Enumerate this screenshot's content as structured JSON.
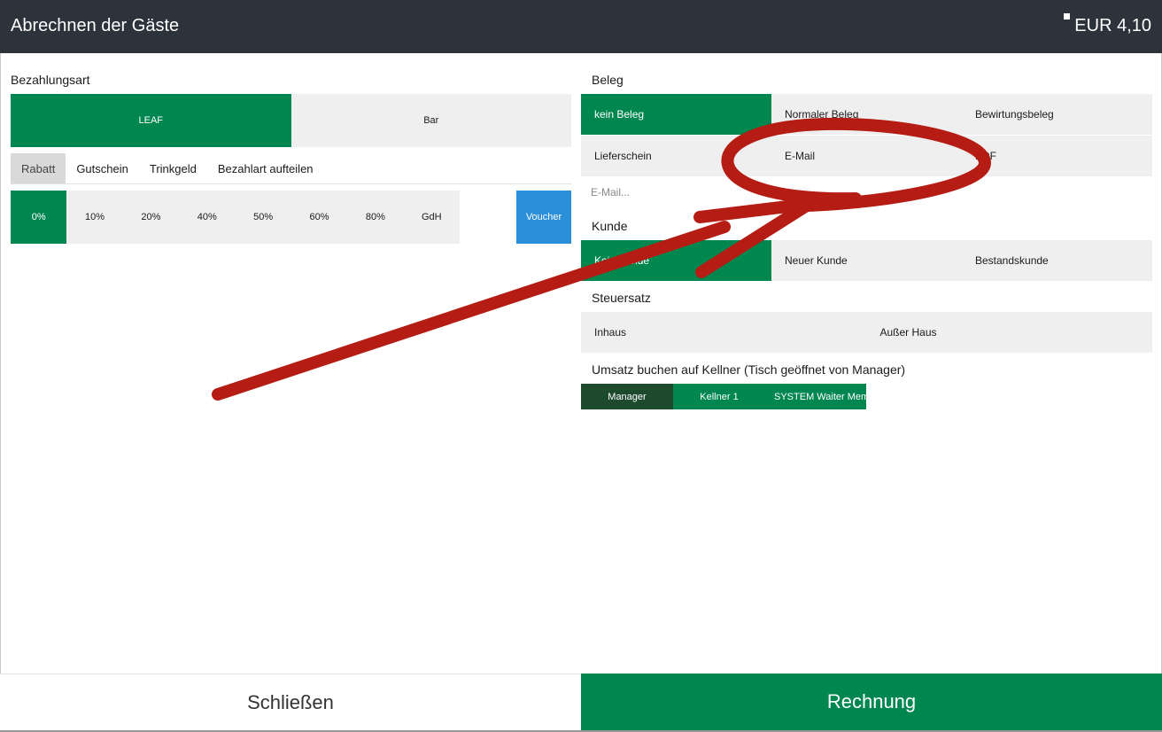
{
  "header": {
    "title": "Abrechnen der Gäste",
    "total": "EUR 4,10"
  },
  "payment": {
    "label": "Bezahlungsart",
    "methods": [
      {
        "label": "LEAF",
        "active": true
      },
      {
        "label": "Bar",
        "active": false
      }
    ]
  },
  "tabs": [
    {
      "label": "Rabatt",
      "active": true
    },
    {
      "label": "Gutschein",
      "active": false
    },
    {
      "label": "Trinkgeld",
      "active": false
    },
    {
      "label": "Bezahlart aufteilen",
      "active": false
    }
  ],
  "discounts": [
    "0%",
    "10%",
    "20%",
    "40%",
    "50%",
    "60%",
    "80%",
    "GdH"
  ],
  "discount_selected": "0%",
  "voucher_label": "Voucher",
  "receipt": {
    "label": "Beleg",
    "row1": [
      {
        "label": "kein Beleg",
        "active": true
      },
      {
        "label": "Normaler Beleg",
        "active": false
      },
      {
        "label": "Bewirtungsbeleg",
        "active": false
      }
    ],
    "row2": [
      {
        "label": "Lieferschein",
        "active": false
      },
      {
        "label": "E-Mail",
        "active": false
      },
      {
        "label": "PDF",
        "active": false
      }
    ],
    "email_placeholder": "E-Mail..."
  },
  "customer": {
    "label": "Kunde",
    "options": [
      {
        "label": "Kein Kunde",
        "active": true
      },
      {
        "label": "Neuer Kunde",
        "active": false
      },
      {
        "label": "Bestandskunde",
        "active": false
      }
    ]
  },
  "tax": {
    "label": "Steuersatz",
    "options": [
      {
        "label": "Inhaus",
        "active": false
      },
      {
        "label": "Außer Haus",
        "active": false
      }
    ]
  },
  "waiter": {
    "label": "Umsatz buchen auf Kellner (Tisch geöffnet von Manager)",
    "options": [
      {
        "label": "Manager",
        "state": "dark"
      },
      {
        "label": "Kellner 1",
        "state": "active"
      },
      {
        "label": "SYSTEM Waiter Mem",
        "state": "active"
      }
    ]
  },
  "footer": {
    "close_label": "Schließen",
    "invoice_label": "Rechnung"
  },
  "annotation_color": "#b51d14"
}
